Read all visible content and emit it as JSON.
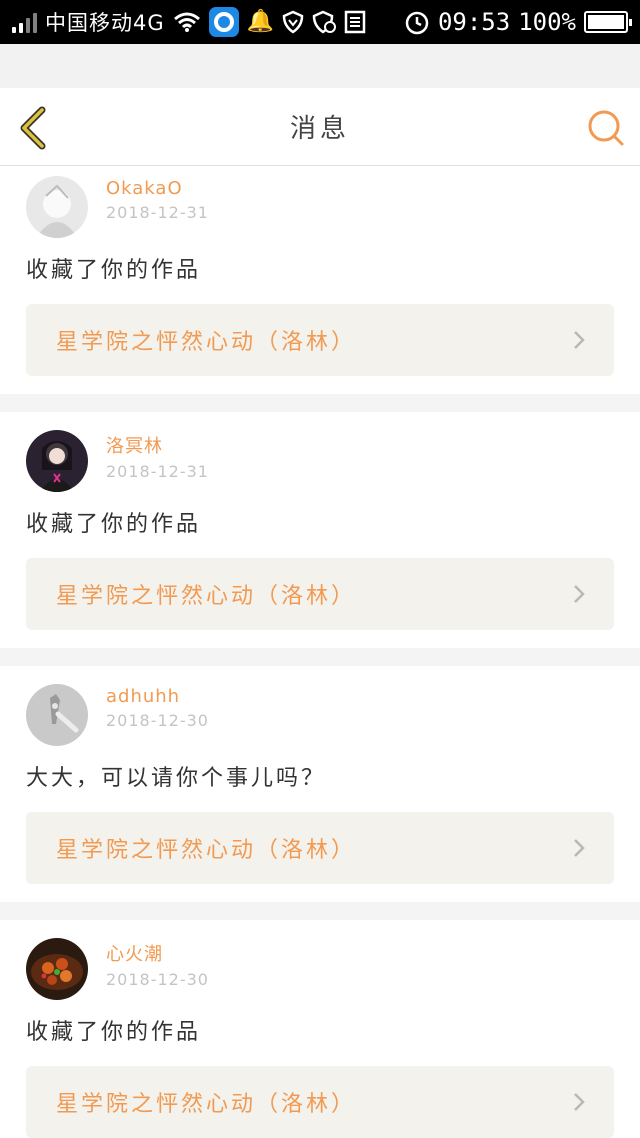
{
  "status_bar": {
    "carrier": "中国移动4G",
    "time": "09:53",
    "battery": "100%"
  },
  "header": {
    "title": "消息"
  },
  "messages": [
    {
      "username": "OkakaO",
      "date": "2018-12-31",
      "text": "收藏了你的作品",
      "work_title": "星学院之怦然心动（洛林）"
    },
    {
      "username": "洛冥林",
      "date": "2018-12-31",
      "text": "收藏了你的作品",
      "work_title": "星学院之怦然心动（洛林）"
    },
    {
      "username": "adhuhh",
      "date": "2018-12-30",
      "text": "大大，可以请你个事儿吗？",
      "work_title": "星学院之怦然心动（洛林）"
    },
    {
      "username": "心火潮",
      "date": "2018-12-30",
      "text": "收藏了你的作品",
      "work_title": "星学院之怦然心动（洛林）"
    }
  ],
  "colors": {
    "accent": "#f29a52",
    "back_arrow": "#e0c23a"
  }
}
